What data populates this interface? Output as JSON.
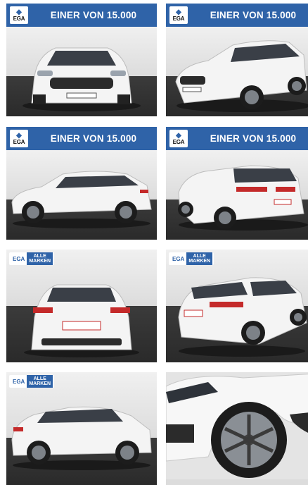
{
  "tiles": [
    {
      "banner": {
        "logo": "EGA",
        "headline": "EINER VON 15.000"
      },
      "view": "front"
    },
    {
      "banner": {
        "logo": "EGA",
        "headline": "EINER VON 15.000"
      },
      "view": "front-three-quarter"
    },
    {
      "banner": {
        "logo": "EGA",
        "headline": "EINER VON 15.000"
      },
      "view": "side"
    },
    {
      "banner": {
        "logo": "EGA",
        "headline": "EINER VON 15.000"
      },
      "view": "rear-three-quarter"
    },
    {
      "badge": {
        "logo": "EGA",
        "tag_line1": "ALLE",
        "tag_line2": "MARKEN"
      },
      "view": "rear"
    },
    {
      "badge": {
        "logo": "EGA",
        "tag_line1": "ALLE",
        "tag_line2": "MARKEN"
      },
      "view": "rear-three-quarter-right"
    },
    {
      "badge": {
        "logo": "EGA",
        "tag_line1": "ALLE",
        "tag_line2": "MARKEN"
      },
      "view": "side-right"
    },
    {
      "view": "wheel-closeup"
    }
  ],
  "colors": {
    "brand_blue": "#2f63a8",
    "car_white": "#f4f4f4",
    "floor_dark": "#2e2e2e",
    "trim_red": "#c42a2a"
  }
}
